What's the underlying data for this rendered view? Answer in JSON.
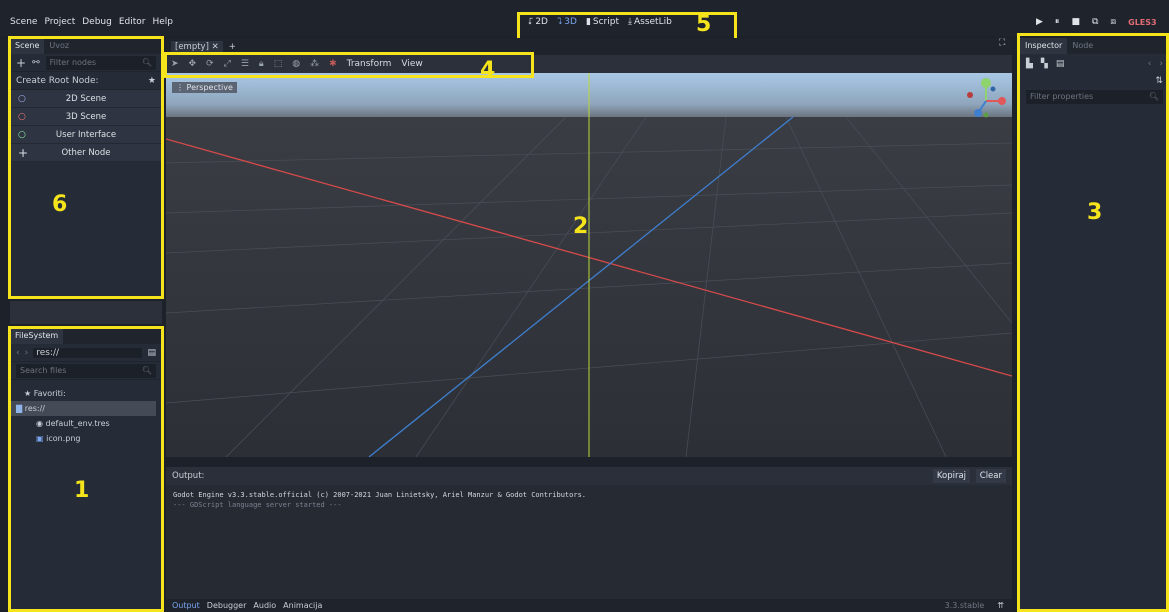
{
  "menu": [
    "Scene",
    "Project",
    "Debug",
    "Editor",
    "Help"
  ],
  "workspaces": [
    {
      "icon": "2d-icon",
      "glyph": "⮦",
      "label": "2D",
      "active": false
    },
    {
      "icon": "3d-icon",
      "glyph": "⮧",
      "label": "3D",
      "active": true
    },
    {
      "icon": "script-icon",
      "glyph": "▮",
      "label": "Script",
      "active": false
    },
    {
      "icon": "assetlib-icon",
      "glyph": "⤓",
      "label": "AssetLib",
      "active": false
    }
  ],
  "playbar": {
    "play": "▶",
    "pause": "⏸",
    "stop": "■",
    "scene": "⧉",
    "custom": "⧈",
    "renderer": "GLES3"
  },
  "scene_dock": {
    "tabs": [
      "Scene",
      "Uvoz"
    ],
    "filter_placeholder": "Filter nodes",
    "create_root_label": "Create Root Node:",
    "nodes": [
      {
        "label": "2D Scene",
        "icon": "node2d-icon",
        "glyph": "○",
        "color": "#a6b4f5"
      },
      {
        "label": "3D Scene",
        "icon": "spatial-icon",
        "glyph": "○",
        "color": "#f57a7a"
      },
      {
        "label": "User Interface",
        "icon": "control-icon",
        "glyph": "○",
        "color": "#8ff0a4"
      },
      {
        "label": "Other Node",
        "icon": "add-icon",
        "glyph": "+",
        "color": "#dfe3e9"
      }
    ]
  },
  "filesystem": {
    "tab": "FileSystem",
    "path": "res://",
    "search_placeholder": "Search files",
    "items": [
      {
        "label": "Favoriti:",
        "glyph": "★",
        "icon": "star-icon",
        "indent": 8,
        "selected": false
      },
      {
        "label": "res://",
        "glyph": "▇",
        "icon": "folder-icon",
        "indent": 2,
        "selected": true
      },
      {
        "label": "default_env.tres",
        "glyph": "◉",
        "icon": "environment-icon",
        "indent": 20,
        "selected": false
      },
      {
        "label": "icon.png",
        "glyph": "▣",
        "icon": "image-icon",
        "indent": 20,
        "selected": false
      }
    ]
  },
  "viewport": {
    "scene_tab": "[empty]",
    "perspective_label": "Perspective",
    "toolbar_labels": [
      "Transform",
      "View"
    ]
  },
  "inspector": {
    "tabs": [
      "Inspector",
      "Node"
    ],
    "filter_placeholder": "Filter properties"
  },
  "output": {
    "label": "Output:",
    "copy_label": "Kopiraj",
    "clear_label": "Clear",
    "lines": [
      "Godot Engine v3.3.stable.official (c) 2007-2021 Juan Linietsky, Ariel Manzur & Godot Contributors.",
      "--- GDScript language server started ---"
    ]
  },
  "bottom_tabs": [
    "Output",
    "Debugger",
    "Audio",
    "Animacija"
  ],
  "version": "3.3.stable",
  "annotations": [
    "1",
    "2",
    "3",
    "4",
    "5",
    "6"
  ]
}
